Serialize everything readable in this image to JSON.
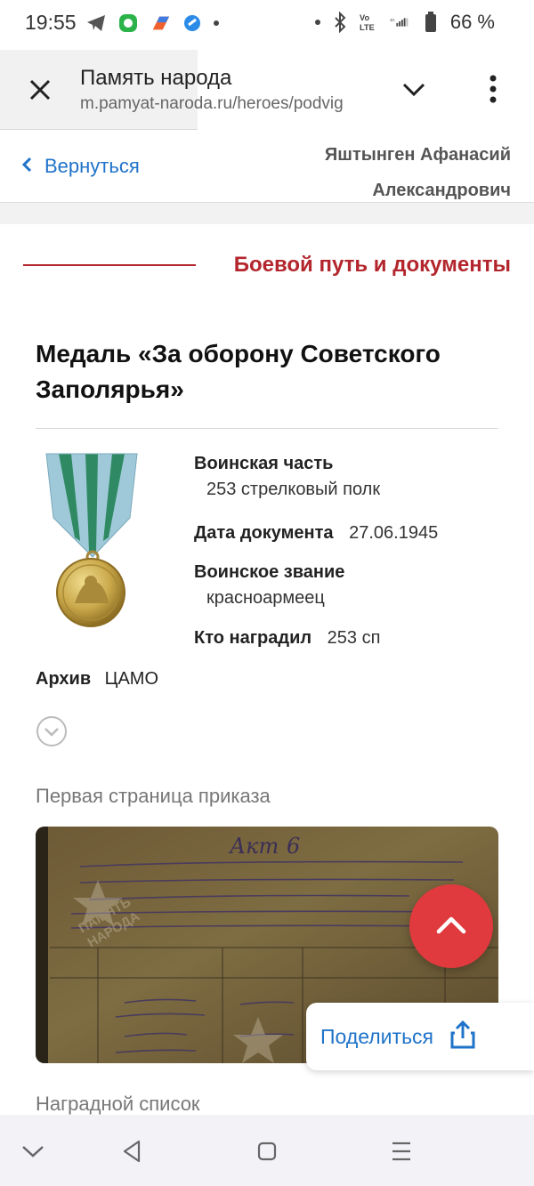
{
  "status_bar": {
    "time": "19:55",
    "battery": "66 %",
    "icons": [
      "telegram-icon",
      "app-green-icon",
      "app-orange-icon",
      "app-blue-icon",
      "dot-icon",
      "bluetooth-icon",
      "volte-icon",
      "signal-icon",
      "battery-icon"
    ]
  },
  "browser": {
    "title": "Память народа",
    "url": "m.pamyat-naroda.ru/heroes/podvig"
  },
  "header": {
    "back_label": "Вернуться",
    "hero_name_line1": "Яштынген Афанасий",
    "hero_name_line2": "Александрович"
  },
  "section": {
    "title": "Боевой путь и документы"
  },
  "award": {
    "title": "Медаль «За оборону Советского Заполярья»",
    "unit_label": "Воинская часть",
    "unit_value": "253 стрелковый полк",
    "date_label": "Дата документа",
    "date_value": "27.06.1945",
    "rank_label": "Воинское звание",
    "rank_value": "красноармеец",
    "awarded_by_label": "Кто наградил",
    "awarded_by_value": "253 сп",
    "archive_label": "Архив",
    "archive_value": "ЦАМО",
    "more_label": "Ещё"
  },
  "documents": {
    "first_page_caption": "Первая страница приказа",
    "watermark": "ПАМЯТЬ НАРОДА",
    "share_label": "Поделиться",
    "next_caption": "Наградной список"
  },
  "colors": {
    "accent_red": "#b3262d",
    "link_blue": "#1f73c9",
    "fab_red": "#e03a3e"
  }
}
